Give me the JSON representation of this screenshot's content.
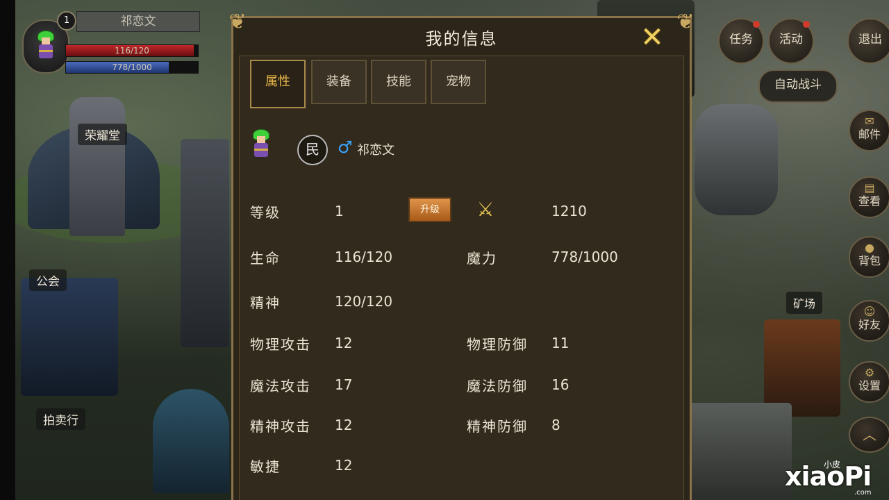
{
  "hud": {
    "level": "1",
    "name": "祁恋文",
    "hp_text": "116/120",
    "hp_fraction": 0.967,
    "mp_text": "778/1000",
    "mp_fraction": 0.778
  },
  "map_labels": {
    "honor_hall": "荣耀堂",
    "guild": "公会",
    "auction": "拍卖行",
    "mine": "矿场"
  },
  "top_menu": {
    "task": "任务",
    "activity": "活动",
    "exit": "退出"
  },
  "auto_battle": "自动战斗",
  "side_menu": {
    "mail": "邮件",
    "book": "查看",
    "bag": "背包",
    "friends": "好友",
    "settings": "设置"
  },
  "panel": {
    "title": "我的信息",
    "tabs": [
      "属性",
      "装备",
      "技能",
      "宠物"
    ],
    "active_tab": 0,
    "character": {
      "class_badge": "民",
      "gender_symbol": "♂",
      "name": "祁恋文"
    },
    "upgrade_label": "升级",
    "stats": {
      "level_label": "等级",
      "level_value": "1",
      "power_value": "1210",
      "hp_label": "生命",
      "hp_value": "116/120",
      "mp_label": "魔力",
      "mp_value": "778/1000",
      "spirit_label": "精神",
      "spirit_value": "120/120",
      "phys_atk_label": "物理攻击",
      "phys_atk_value": "12",
      "phys_def_label": "物理防御",
      "phys_def_value": "11",
      "mag_atk_label": "魔法攻击",
      "mag_atk_value": "17",
      "mag_def_label": "魔法防御",
      "mag_def_value": "16",
      "spirit_atk_label": "精神攻击",
      "spirit_atk_value": "12",
      "spirit_def_label": "精神防御",
      "spirit_def_value": "8",
      "agility_label": "敏捷",
      "agility_value": "12"
    }
  },
  "watermark": {
    "small": "小皮",
    "main": "xiaoPi",
    "url": ".com"
  }
}
